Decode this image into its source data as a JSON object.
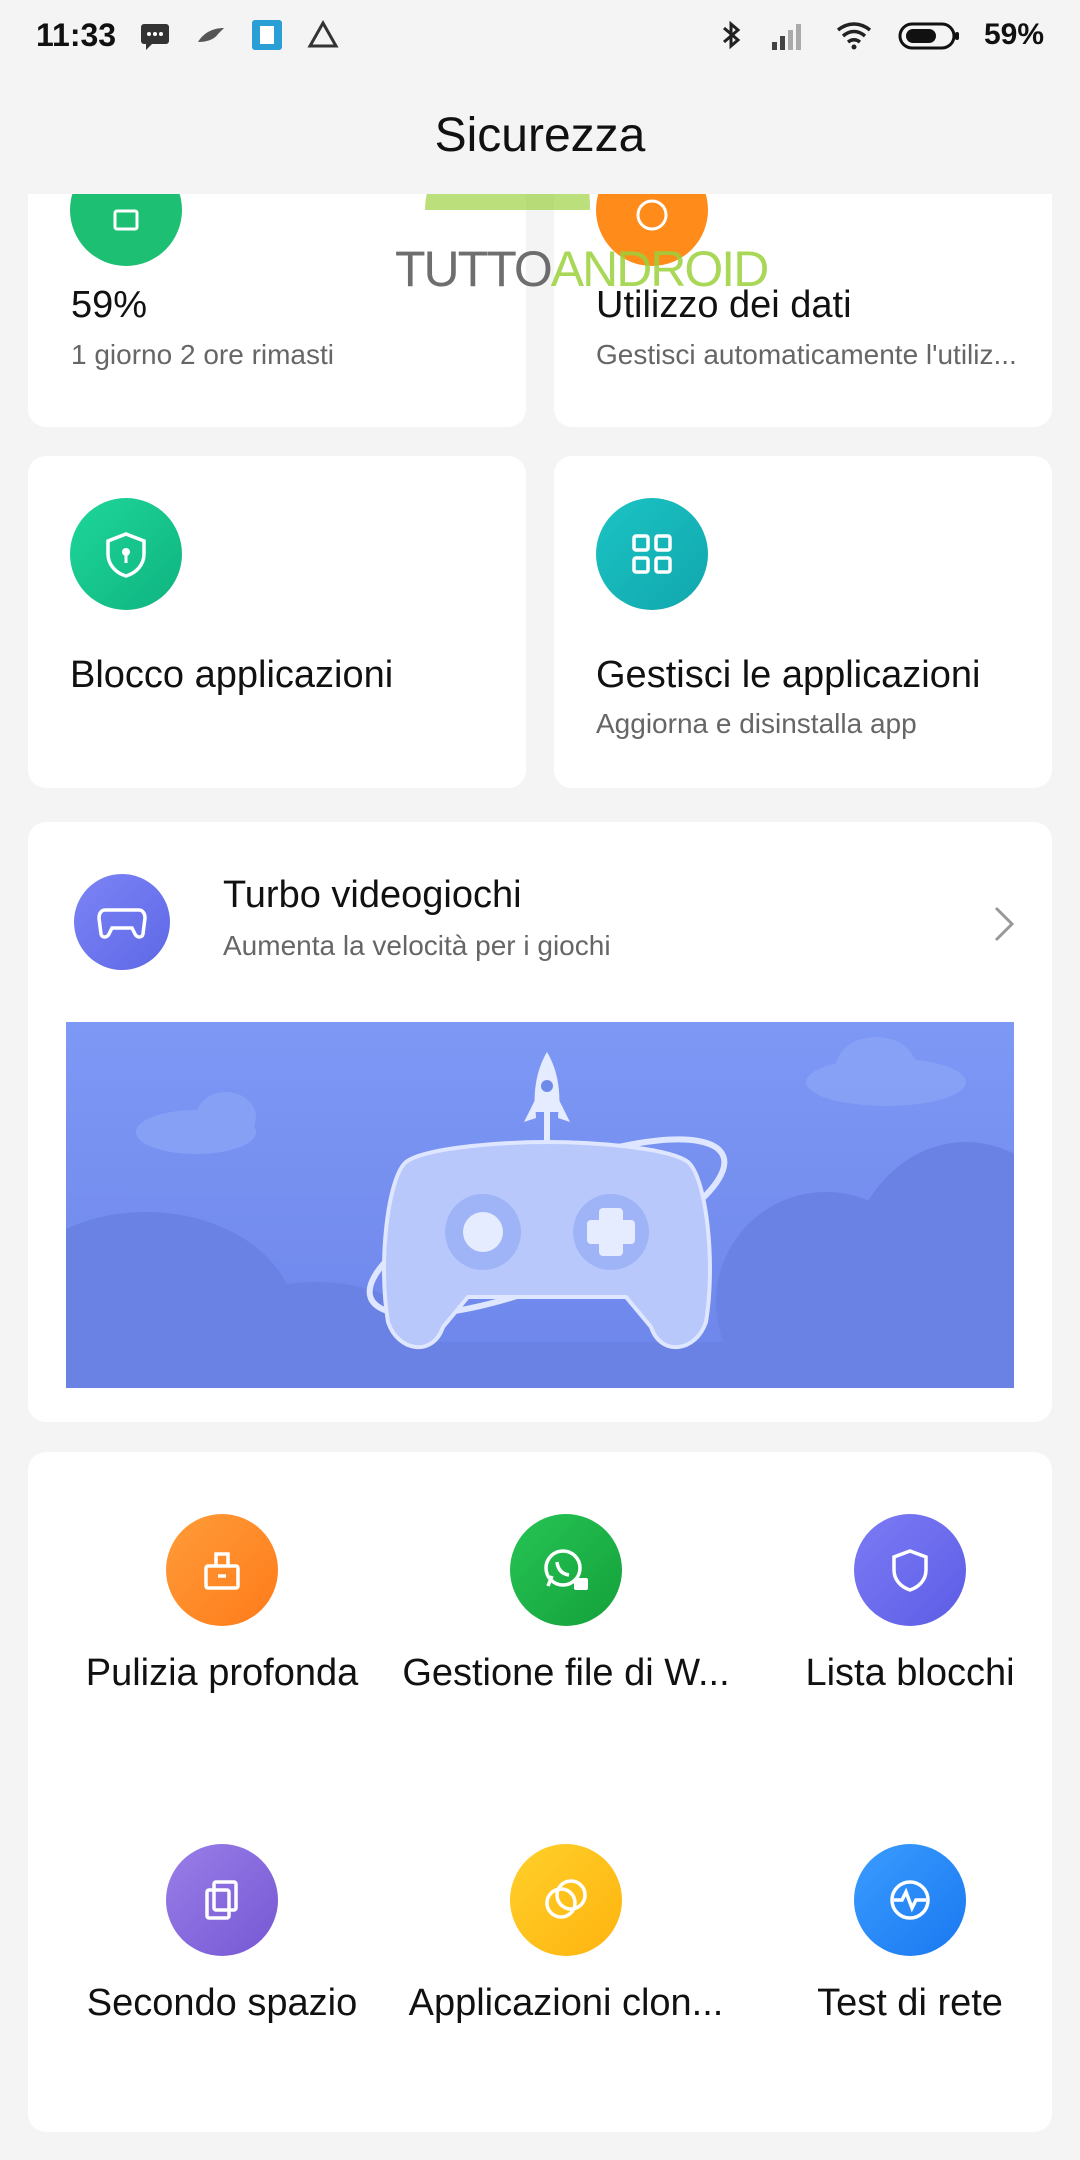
{
  "status_bar": {
    "time": "11:33",
    "battery_percent": "59%",
    "left_icons": [
      "message-icon",
      "bird-icon",
      "sim-icon",
      "drive-icon"
    ],
    "right_icons": [
      "bluetooth-icon",
      "signal-icon",
      "wifi-icon",
      "battery-icon"
    ]
  },
  "header": {
    "title": "Sicurezza"
  },
  "watermark": {
    "part1": "TUTTO",
    "part2": "ANDROID"
  },
  "top_cards": [
    {
      "title": "59%",
      "subtitle": "1 giorno 2 ore  rimasti",
      "icon": "battery-icon",
      "color": "#1dbf73"
    },
    {
      "title": "Utilizzo dei dati",
      "subtitle": "Gestisci automaticamente l'utiliz...",
      "icon": "data-icon",
      "color": "#ff8c1a"
    }
  ],
  "mid_cards": [
    {
      "title": "Blocco applicazioni",
      "subtitle": "",
      "icon": "shield-lock-icon",
      "color": "#16c28b"
    },
    {
      "title": "Gestisci le applicazioni",
      "subtitle": "Aggiorna e disinstalla app",
      "icon": "apps-grid-icon",
      "color": "#16b6b6"
    }
  ],
  "turbo": {
    "title": "Turbo videogiochi",
    "subtitle": "Aumenta la velocità per i giochi",
    "icon": "gamepad-icon",
    "color": "#6f7cf0"
  },
  "tools": [
    {
      "label": "Pulizia profonda",
      "icon": "deep-clean-icon",
      "color": "#ff8a2a"
    },
    {
      "label": "Gestione file di W...",
      "icon": "whatsapp-icon",
      "color": "#1fb14a"
    },
    {
      "label": "Lista blocchi",
      "icon": "shield-icon",
      "color": "#6f6ff0"
    },
    {
      "label": "Secondo spazio",
      "icon": "second-space-icon",
      "color": "#8a6ee0"
    },
    {
      "label": "Applicazioni clon...",
      "icon": "clone-apps-icon",
      "color": "#ffc21a"
    },
    {
      "label": "Test di rete",
      "icon": "network-test-icon",
      "color": "#2a8cff"
    }
  ]
}
